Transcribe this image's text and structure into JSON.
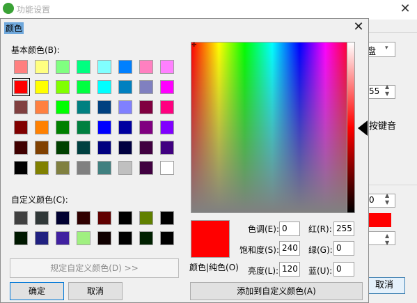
{
  "background_window": {
    "title": "功能设置",
    "close_glyph": "✕",
    "combo_value": "盘",
    "combo_arrow": "▾",
    "spin1_value": "55",
    "spin_arrows": "▲\n▼",
    "hotkey_text": "按键音",
    "spin2_value": "0",
    "cancel_label": "取消",
    "swatch_color": "#ff0000"
  },
  "dialog": {
    "title": "颜色",
    "close_glyph": "✕",
    "basic_colors_label": "基本颜色(B):",
    "custom_colors_label": "自定义颜色(C):",
    "define_custom_label": "规定自定义颜色(D) >>",
    "ok_label": "确定",
    "cancel_label": "取消",
    "add_custom_label": "添加到自定义颜色(A)",
    "preview_label": "颜色|纯色(O)",
    "fields": {
      "hue": {
        "label": "色调(E):",
        "value": "0"
      },
      "sat": {
        "label": "饱和度(S):",
        "value": "240"
      },
      "lum": {
        "label": "亮度(L):",
        "value": "120"
      },
      "red": {
        "label": "红(R):",
        "value": "255"
      },
      "green": {
        "label": "绿(G):",
        "value": "0"
      },
      "blue": {
        "label": "蓝(U):",
        "value": "0"
      }
    },
    "selected_color": "#ff0000",
    "basic_colors": [
      [
        "#ff8080",
        "#ffff80",
        "#80ff80",
        "#00ff80",
        "#80ffff",
        "#0080ff",
        "#ff80c0",
        "#ff80ff"
      ],
      [
        "#ff0000",
        "#ffff00",
        "#80ff00",
        "#00ff40",
        "#00ffff",
        "#0080c0",
        "#8080c0",
        "#ff00ff"
      ],
      [
        "#804040",
        "#ff8040",
        "#00ff00",
        "#008080",
        "#004080",
        "#8080ff",
        "#800040",
        "#ff0080"
      ],
      [
        "#800000",
        "#ff8000",
        "#008000",
        "#008040",
        "#0000ff",
        "#0000a0",
        "#800080",
        "#8000ff"
      ],
      [
        "#400000",
        "#804000",
        "#004000",
        "#004040",
        "#000080",
        "#000040",
        "#400040",
        "#400080"
      ],
      [
        "#000000",
        "#808000",
        "#808040",
        "#808080",
        "#408080",
        "#c0c0c0",
        "#400040",
        "#ffffff"
      ]
    ],
    "custom_colors": [
      [
        "#404040",
        "#303838",
        "#000030",
        "#300000",
        "#600000",
        "#000000",
        "#608000",
        "#000000"
      ],
      [
        "#001800",
        "#202080",
        "#4020a0",
        "#a0f080",
        "#100000",
        "#000000",
        "#002000",
        "#000000"
      ]
    ]
  }
}
